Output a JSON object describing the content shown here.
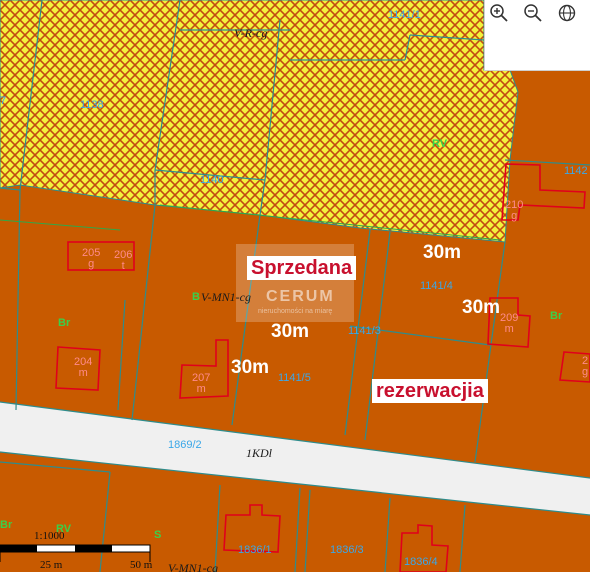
{
  "map": {
    "labels": {
      "sold": "Sprzedana",
      "reserved": "rezerwacjia",
      "dim_top_right": "30m",
      "dim_mid_right": "30m",
      "dim_center": "30m",
      "dim_left": "30m"
    },
    "zones": {
      "v_r_cg": "V-R-cg",
      "v_mn1_cg": "V-MN1-cg",
      "road": "1KDl",
      "rv": "RV",
      "br_left": "Br",
      "br_right": "Br",
      "b_prefix": "B",
      "s": "S",
      "bottom_br": "Br",
      "bottom_rv": "RV"
    },
    "parcels": [
      "1141/1",
      "1138",
      "1140",
      "1142",
      "1141/4",
      "1141/3",
      "1141/5",
      "1869/2",
      "1836/1",
      "1836/3",
      "1836/4",
      "7"
    ],
    "buildings": [
      {
        "num": "205",
        "type": "g"
      },
      {
        "num": "206",
        "type": "t"
      },
      {
        "num": "204",
        "type": "m"
      },
      {
        "num": "207",
        "type": "m"
      },
      {
        "num": "209",
        "type": "m"
      },
      {
        "num": "210",
        "type": "g"
      },
      {
        "num": "2",
        "type": "g"
      }
    ],
    "watermark": {
      "brand": "CERUM",
      "tagline": "nieruchomości na miarę"
    },
    "scale": {
      "ratio": "1:1000",
      "mark_25": "25 m",
      "mark_50": "50 m",
      "bottom_text": "V-MN1-cg"
    }
  },
  "controls": {
    "zoom_in": "zoom-in-icon",
    "zoom_out": "zoom-out-icon",
    "globe": "globe-icon"
  },
  "colors": {
    "agricultural": "#f2f23c",
    "residential": "#c85a00",
    "road": "#f0f0f0",
    "parcel_line": "#2e8c8c",
    "building": "#e0001b",
    "label_red": "#c8102e"
  }
}
